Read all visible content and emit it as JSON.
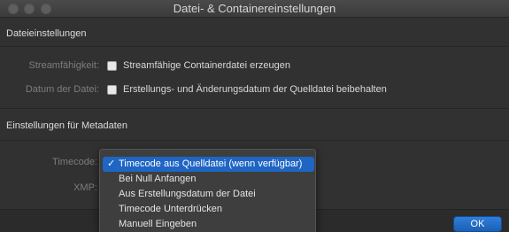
{
  "window": {
    "title": "Datei- & Containereinstellungen"
  },
  "file_settings": {
    "heading": "Dateieinstellungen",
    "streamable": {
      "label": "Streamfähigkeit:",
      "checkbox_label": "Streamfähige Containerdatei erzeugen",
      "checked": false
    },
    "file_date": {
      "label": "Datum der Datei:",
      "checkbox_label": "Erstellungs- und Änderungsdatum der Quelldatei beibehalten",
      "checked": false
    }
  },
  "metadata_settings": {
    "heading": "Einstellungen für Metadaten",
    "timecode_label": "Timecode:",
    "xmp_label": "XMP:"
  },
  "timecode_menu": {
    "check_glyph": "✓",
    "items": [
      {
        "label": "Timecode aus Quelldatei (wenn verfügbar)",
        "selected": true
      },
      {
        "label": "Bei Null Anfangen",
        "selected": false
      },
      {
        "label": "Aus Erstellungsdatum der Datei",
        "selected": false
      },
      {
        "label": "Timecode Unterdrücken",
        "selected": false
      },
      {
        "label": "Manuell Eingeben",
        "selected": false
      }
    ]
  },
  "footer": {
    "ok_label": "OK"
  },
  "colors": {
    "accent": "#1f65c3",
    "background": "#313131",
    "ok_button": "#2f7fd9"
  }
}
